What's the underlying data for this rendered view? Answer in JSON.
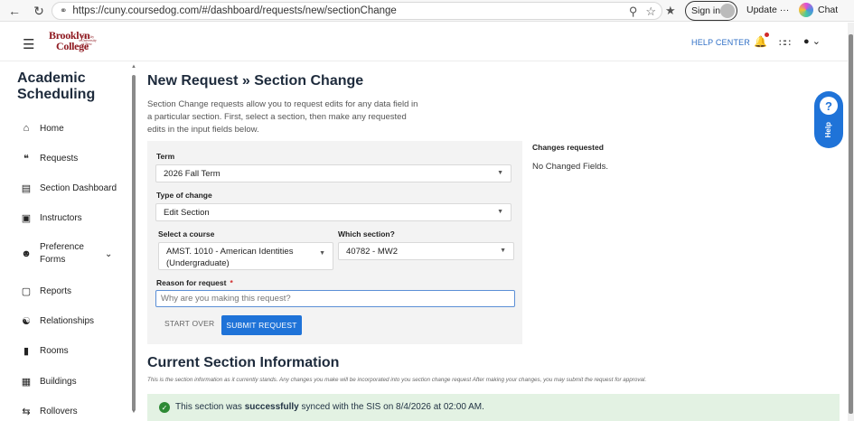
{
  "browser": {
    "url": "https://cuny.coursedog.com/#/dashboard/requests/new/sectionChange",
    "sign_in": "Sign in",
    "update": "Update",
    "chat": "Chat"
  },
  "header": {
    "logo_line1": "Brooklyn",
    "logo_line2": "College",
    "logo_tiny": "The City University of New York",
    "help_center": "HELP CENTER"
  },
  "sidebar": {
    "title": "Academic Scheduling",
    "items": [
      {
        "label": "Home",
        "icon": "home-icon"
      },
      {
        "label": "Requests",
        "icon": "quote-icon"
      },
      {
        "label": "Section Dashboard",
        "icon": "clipboard-icon"
      },
      {
        "label": "Instructors",
        "icon": "contact-icon"
      },
      {
        "label": "Preference Forms",
        "icon": "people-icon"
      },
      {
        "label": "Reports",
        "icon": "inbox-icon"
      },
      {
        "label": "Relationships",
        "icon": "group-icon"
      },
      {
        "label": "Rooms",
        "icon": "door-icon"
      },
      {
        "label": "Buildings",
        "icon": "building-icon"
      },
      {
        "label": "Rollovers",
        "icon": "swap-icon"
      }
    ]
  },
  "main": {
    "title": "New Request » Section Change",
    "intro": "Section Change requests allow you to request edits for any data field in a particular section. First, select a section, then make any requested edits in the input fields below.",
    "form": {
      "term_label": "Term",
      "term_value": "2026 Fall Term",
      "type_label": "Type of change",
      "type_value": "Edit Section",
      "course_label": "Select a course",
      "course_value": "AMST. 1010 - American Identities (Undergraduate)",
      "section_label": "Which section?",
      "section_value": "40782 - MW2",
      "reason_label": "Reason for request",
      "reason_required": "*",
      "reason_placeholder": "Why are you making this request?",
      "start_over": "START OVER",
      "submit": "SUBMIT REQUEST"
    },
    "changes": {
      "title": "Changes requested",
      "value": "No Changed Fields."
    },
    "current_section": {
      "title": "Current Section Information",
      "note": "This is the section information as it currently stands. Any changes you make will be incorporated into you section change request After making your changes, you may submit the request for approval.",
      "success_prefix": "This section was",
      "success_bold": "successfully",
      "success_suffix": "synced with the SIS on 8/4/2026 at 02:00 AM."
    }
  },
  "help_widget": {
    "label": "Help",
    "symbol": "?"
  },
  "colors": {
    "accent": "#1f73d8",
    "brand": "#8f1a21",
    "success_bg": "#e3f2e3"
  }
}
